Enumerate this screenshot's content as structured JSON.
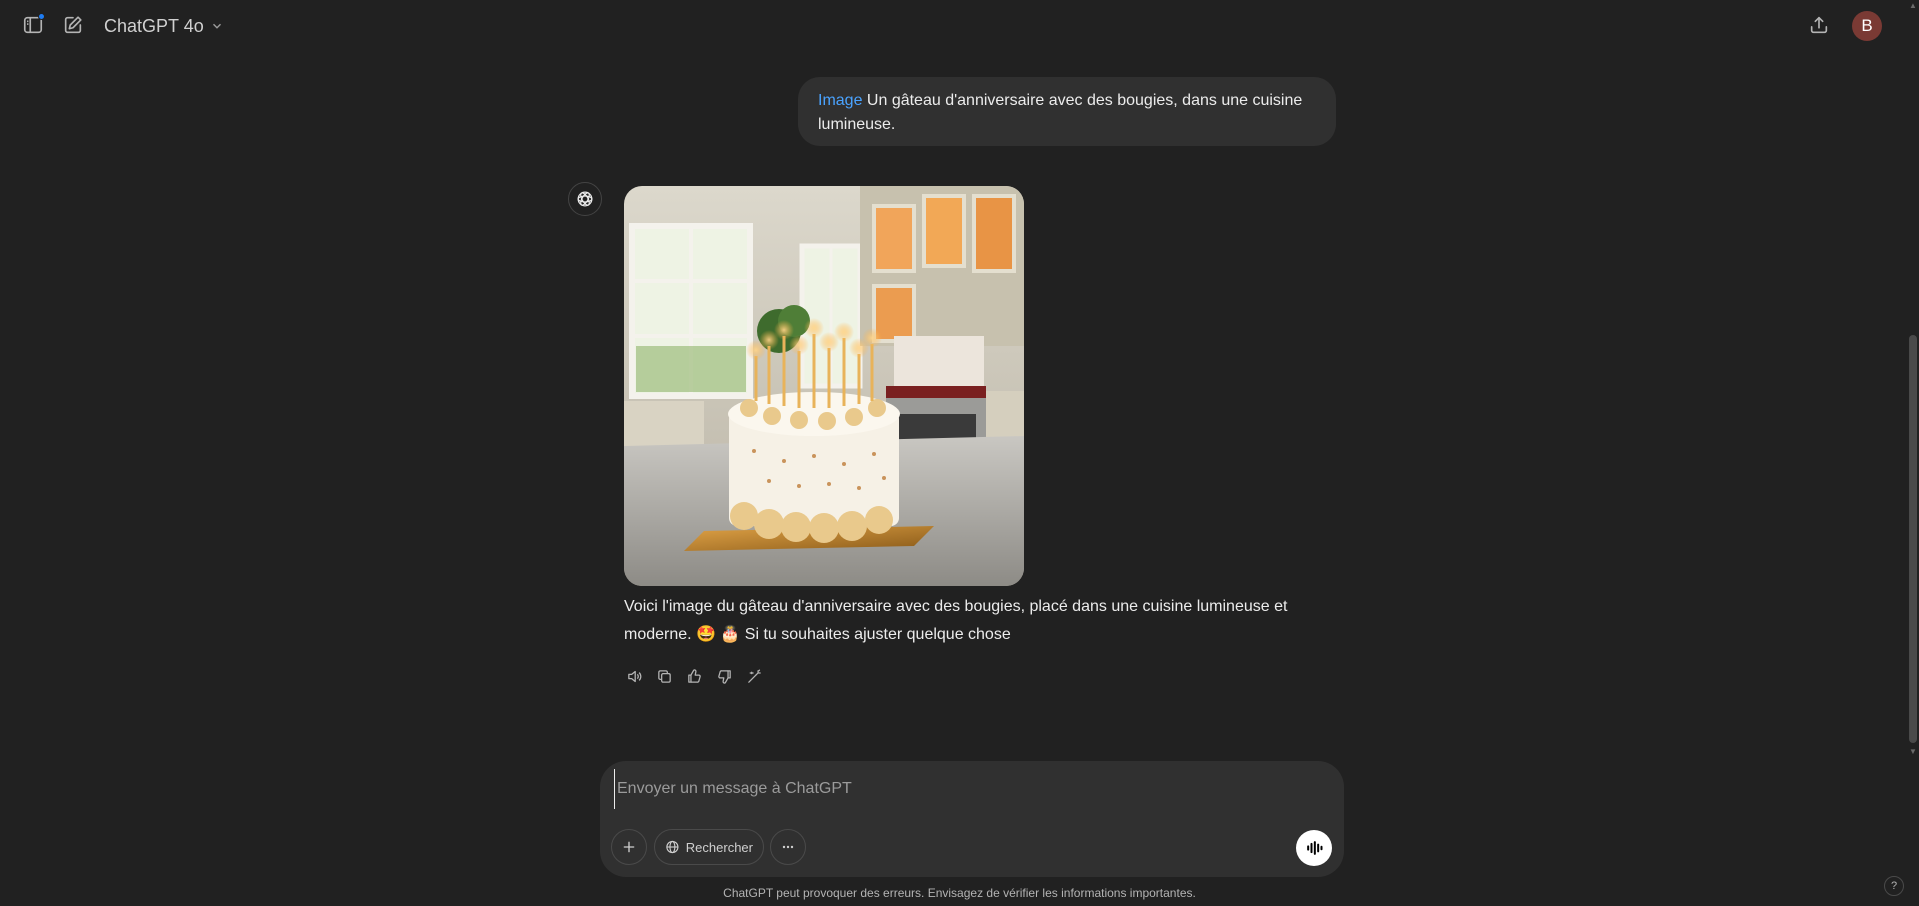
{
  "header": {
    "model_name": "ChatGPT 4o",
    "avatar_initial": "B"
  },
  "conversation": {
    "user_message": {
      "tag": "Image",
      "text": " Un gâteau d'anniversaire avec des bougies, dans une cuisine lumineuse."
    },
    "assistant_message": {
      "text": "Voici l'image du gâteau d'anniversaire avec des bougies, placé dans une cuisine lumineuse et moderne. 🤩 🎂 Si tu souhaites ajuster quelque chose"
    }
  },
  "composer": {
    "placeholder": "Envoyer un message à ChatGPT",
    "search_label": "Rechercher"
  },
  "footer": {
    "disclaimer": "ChatGPT peut provoquer des erreurs. Envisagez de vérifier les informations importantes.",
    "help_label": "?"
  },
  "colors": {
    "background": "#212121",
    "bubble": "#303030",
    "accent_link": "#4aa3ff",
    "notification_dot": "#1e7cf2",
    "avatar_bg": "#7a3a34"
  },
  "icons": [
    "sidebar-toggle-icon",
    "new-chat-icon",
    "chevron-down-icon",
    "share-icon",
    "openai-logo-icon",
    "read-aloud-icon",
    "copy-icon",
    "thumbs-up-icon",
    "thumbs-down-icon",
    "edit-image-icon",
    "plus-icon",
    "globe-icon",
    "more-icon",
    "voice-icon"
  ]
}
